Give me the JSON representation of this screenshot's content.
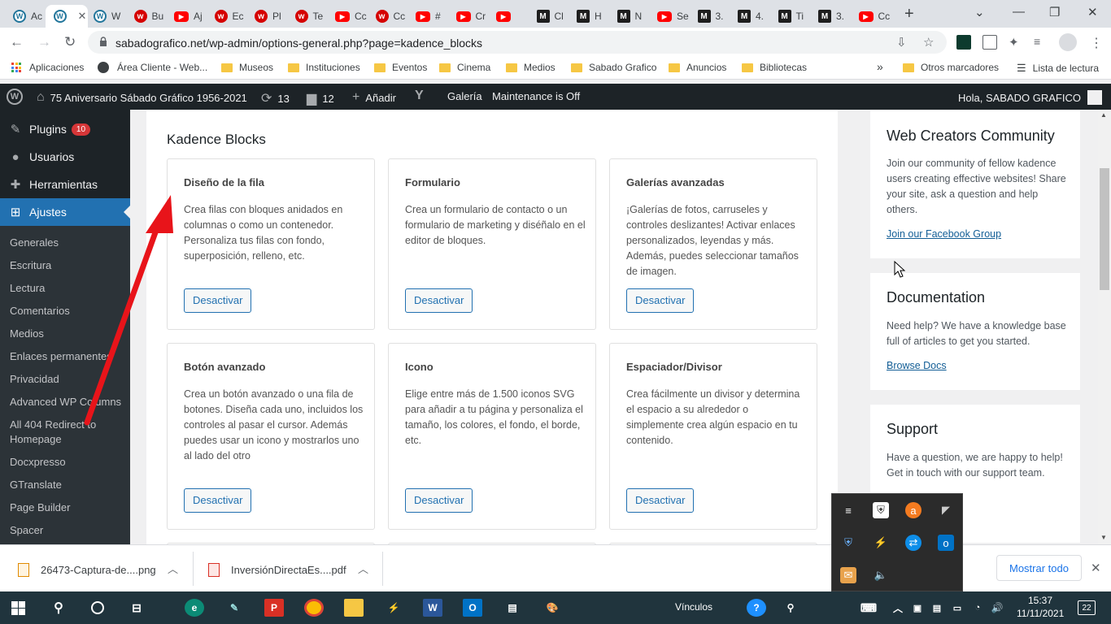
{
  "browser": {
    "tabs": [
      {
        "icon": "wordpress-icon",
        "title": "Ac"
      },
      {
        "icon": "wordpress-icon",
        "title": ""
      },
      {
        "icon": "wordpress-icon",
        "title": "W"
      },
      {
        "icon": "red-circle-icon",
        "title": "Bu"
      },
      {
        "icon": "youtube-icon",
        "title": "Aj"
      },
      {
        "icon": "red-circle-icon",
        "title": "Ec"
      },
      {
        "icon": "red-circle-icon",
        "title": "Pl"
      },
      {
        "icon": "red-circle-icon",
        "title": "Te"
      },
      {
        "icon": "youtube-icon",
        "title": "Cc"
      },
      {
        "icon": "red-circle-icon",
        "title": "Cc"
      },
      {
        "icon": "youtube-icon",
        "title": "#"
      },
      {
        "icon": "youtube-icon",
        "title": "Cr"
      },
      {
        "icon": "youtube-icon",
        "title": ""
      },
      {
        "icon": "m-icon",
        "title": "Cl"
      },
      {
        "icon": "m-icon",
        "title": "H"
      },
      {
        "icon": "m-icon",
        "title": "N"
      },
      {
        "icon": "youtube-icon",
        "title": "Se"
      },
      {
        "icon": "m-icon",
        "title": "3."
      },
      {
        "icon": "m-icon",
        "title": "4."
      },
      {
        "icon": "m-icon",
        "title": "Ti"
      },
      {
        "icon": "m-icon",
        "title": "3."
      },
      {
        "icon": "youtube-icon",
        "title": "Cc"
      }
    ],
    "url": "sabadografico.net/wp-admin/options-general.php?page=kadence_blocks",
    "bookmarks": {
      "apps": "Aplicaciones",
      "cliente": "Área Cliente - Web...",
      "items": [
        "Museos",
        "Instituciones",
        "Eventos",
        "Cinema",
        "Medios",
        "Sabado Grafico",
        "Anuncios",
        "Bibliotecas"
      ],
      "more": "»",
      "others": "Otros marcadores",
      "reading": "Lista de lectura"
    }
  },
  "adminbar": {
    "site": "75 Aniversario Sábado Gráfico 1956-2021",
    "updates": "13",
    "comments": "12",
    "add": "Añadir",
    "gallery": "Galería",
    "maintenance": "Maintenance is Off",
    "greeting": "Hola, SABADO GRAFICO"
  },
  "sidebar": {
    "top": [
      {
        "label": "Plugins",
        "badge": "10",
        "icon": "plugin-icon"
      },
      {
        "label": "Usuarios",
        "icon": "users-icon"
      },
      {
        "label": "Herramientas",
        "icon": "tools-icon"
      },
      {
        "label": "Ajustes",
        "icon": "settings-icon"
      }
    ],
    "submenu": [
      "Generales",
      "Escritura",
      "Lectura",
      "Comentarios",
      "Medios",
      "Enlaces permanentes",
      "Privacidad",
      "Advanced WP Columns",
      "All 404 Redirect to Homepage",
      "Docxpresso",
      "GTranslate",
      "Page Builder",
      "Spacer"
    ]
  },
  "main": {
    "title": "Kadence Blocks",
    "cards": [
      {
        "title": "Diseño de la fila",
        "desc": "Crea filas con bloques anidados en columnas o como un contenedor. Personaliza tus filas con fondo, superposición, relleno, etc.",
        "button": "Desactivar"
      },
      {
        "title": "Formulario",
        "desc": "Crea un formulario de contacto o un formulario de marketing y diséñalo en el editor de bloques.",
        "button": "Desactivar"
      },
      {
        "title": "Galerías avanzadas",
        "desc": "¡Galerías de fotos, carruseles y controles deslizantes! Activar enlaces personalizados, leyendas y más. Además, puedes seleccionar tamaños de imagen.",
        "button": "Desactivar"
      },
      {
        "title": "Botón avanzado",
        "desc": "Crea un botón avanzado o una fila de botones. Diseña cada uno, incluidos los controles al pasar el cursor. Además puedes usar un icono y mostrarlos uno al lado del otro",
        "button": "Desactivar"
      },
      {
        "title": "Icono",
        "desc": "Elige entre más de 1.500 iconos SVG para añadir a tu página y personaliza el tamaño, los colores, el fondo, el borde, etc.",
        "button": "Desactivar"
      },
      {
        "title": "Espaciador/Divisor",
        "desc": "Crea fácilmente un divisor y determina el espacio a su alrededor o simplemente crea algún espacio en tu contenido.",
        "button": "Desactivar"
      }
    ]
  },
  "right": {
    "community": {
      "title": "Web Creators Community",
      "text": "Join our community of fellow kadence users creating effective websites! Share your site, ask a question and help others.",
      "link": "Join our Facebook Group"
    },
    "docs": {
      "title": "Documentation",
      "text": "Need help? We have a knowledge base full of articles to get you started.",
      "link": "Browse Docs"
    },
    "support": {
      "title": "Support",
      "text": "Have a question, we are happy to help! Get in touch with our support team."
    }
  },
  "downloads": {
    "files": [
      "26473-Captura-de....png",
      "InversiónDirectaEs....pdf"
    ],
    "show_all": "Mostrar todo"
  },
  "taskbar": {
    "links": "Vínculos",
    "time": "15:37",
    "date": "11/11/2021",
    "notifications": "22"
  },
  "colors": {
    "wp_dark": "#1d2327",
    "wp_blue": "#2271b1",
    "arrow_red": "#e8141a",
    "taskbar": "#20343d"
  }
}
